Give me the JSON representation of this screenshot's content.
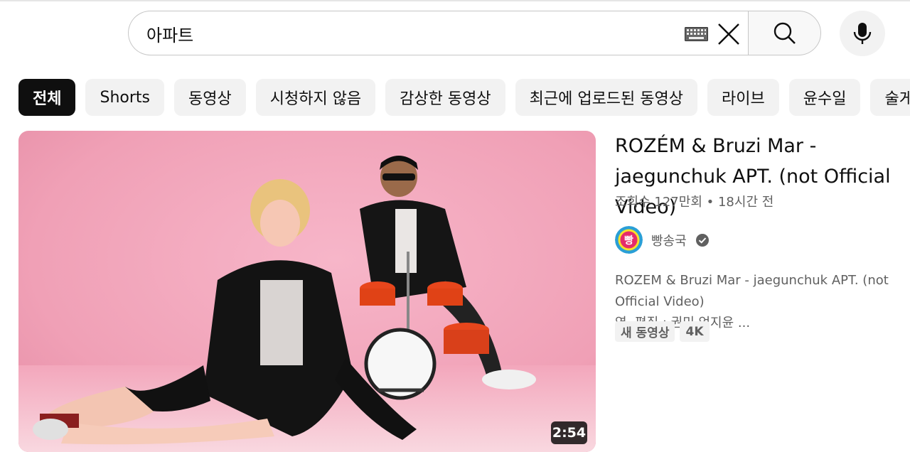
{
  "search": {
    "query": "아파트"
  },
  "chips": [
    {
      "label": "전체",
      "active": true
    },
    {
      "label": "Shorts"
    },
    {
      "label": "동영상"
    },
    {
      "label": "시청하지 않음"
    },
    {
      "label": "감상한 동영상"
    },
    {
      "label": "최근에 업로드된 동영상"
    },
    {
      "label": "라이브"
    },
    {
      "label": "윤수일"
    },
    {
      "label": "술게"
    }
  ],
  "video": {
    "title": "ROZÉM & Bruzi Mar - jaegunchuk APT. (not Official Video)",
    "views": "조회수 127만회",
    "separator": "•",
    "age": "18시간 전",
    "duration": "2:54",
    "channel": {
      "name": "빵송국",
      "avatar_text": "빵",
      "verified": true
    },
    "description": "ROZEM & Bruzi Mar - jaegunchuk APT. (not Official Video)\n영, 편집 : 권민 엄지윤 ...",
    "badges": [
      "새 동영상",
      "4K"
    ]
  },
  "colors": {
    "accent_chip_bg": "#0f0f0f",
    "chip_bg": "#f2f2f2",
    "secondary_text": "#606060",
    "thumbnail_bg": "#f2a4bb"
  },
  "icons": [
    "keyboard-icon",
    "close-icon",
    "search-icon",
    "mic-icon",
    "verified-icon"
  ]
}
